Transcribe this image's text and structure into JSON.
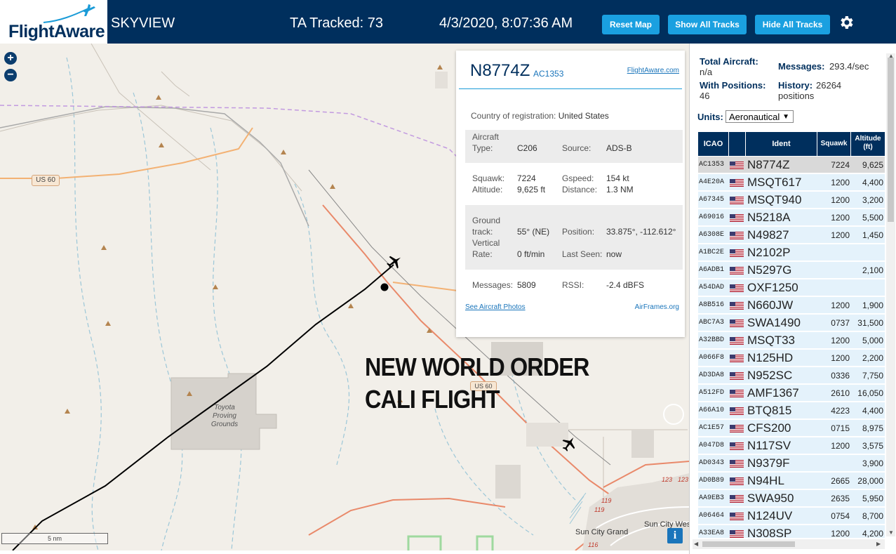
{
  "header": {
    "logo_text": "FlightAware",
    "site_title": "SKYVIEW",
    "ta_tracked": "TA Tracked: 73",
    "datetime": "4/3/2020, 8:07:36 AM",
    "buttons": {
      "reset": "Reset Map",
      "show_all": "Show All Tracks",
      "hide_all": "Hide All Tracks"
    },
    "colors": {
      "bar": "#002f5d",
      "button": "#1aa0e0"
    }
  },
  "map": {
    "zoom_in": "+",
    "zoom_out": "−",
    "scale": "5 nm",
    "info": "i",
    "overlay_line1": "NEW WORLD ORDER",
    "overlay_line2": "CALI FLIGHT",
    "labels": {
      "us60_a": "US 60",
      "us60_b": "US 60",
      "toyota1": "Toyota",
      "toyota2": "Proving",
      "toyota3": "Grounds",
      "r119a": "119",
      "r119b": "119",
      "r123a": "123",
      "r123b": "123",
      "r116": "116",
      "sun_city_grand": "Sun City Grand",
      "sun_city_west": "Sun City West"
    }
  },
  "popup": {
    "ident": "N8774Z",
    "icao": "AC1353",
    "fa_link": "FlightAware.com",
    "country_label": "Country of registration:",
    "country_value": "United States",
    "aircraft_type_label1": "Aircraft",
    "aircraft_type_label2": "Type:",
    "aircraft_type": "C206",
    "source_label": "Source:",
    "source": "ADS-B",
    "squawk_label": "Squawk:",
    "squawk": "7224",
    "gspeed_label": "Gspeed:",
    "gspeed": "154 kt",
    "altitude_label": "Altitude:",
    "altitude": "9,625 ft",
    "distance_label": "Distance:",
    "distance": "1.3 NM",
    "gtrack_label1": "Ground",
    "gtrack_label2": "track:",
    "gtrack": "55° (NE)",
    "position_label": "Position:",
    "position": "33.875°, -112.612°",
    "vrate_label1": "Vertical",
    "vrate_label2": "Rate:",
    "vrate": "0 ft/min",
    "lastseen_label": "Last Seen:",
    "lastseen": "now",
    "messages_label": "Messages:",
    "messages": "5809",
    "rssi_label": "RSSI:",
    "rssi": "-2.4 dBFS",
    "photos_link": "See Aircraft Photos",
    "airframes_link": "AirFrames.org"
  },
  "panel": {
    "total_aircraft_label": "Total Aircraft:",
    "total_aircraft": "n/a",
    "messages_label": "Messages:",
    "messages": "293.4/sec",
    "with_positions_label": "With Positions:",
    "with_positions": "46",
    "history_label": "History:",
    "history_value": "26264",
    "history_unit": "positions",
    "units_label": "Units:",
    "units_value": "Aeronautical",
    "columns": {
      "icao": "ICAO",
      "ident": "Ident",
      "squawk": "Squawk",
      "alt1": "Altitude",
      "alt2": "(ft)"
    },
    "rows": [
      {
        "icao": "AC1353",
        "ident": "N8774Z",
        "squawk": "7224",
        "alt": "9,625"
      },
      {
        "icao": "A4E20A",
        "ident": "MSQT617",
        "squawk": "1200",
        "alt": "4,400"
      },
      {
        "icao": "A67345",
        "ident": "MSQT940",
        "squawk": "1200",
        "alt": "3,200"
      },
      {
        "icao": "A69016",
        "ident": "N5218A",
        "squawk": "1200",
        "alt": "5,500"
      },
      {
        "icao": "A6308E",
        "ident": "N49827",
        "squawk": "1200",
        "alt": "1,450"
      },
      {
        "icao": "A1BC2E",
        "ident": "N2102P",
        "squawk": "",
        "alt": ""
      },
      {
        "icao": "A6ADB1",
        "ident": "N5297G",
        "squawk": "",
        "alt": "2,100"
      },
      {
        "icao": "A54DAD",
        "ident": "OXF1250",
        "squawk": "",
        "alt": ""
      },
      {
        "icao": "A8B516",
        "ident": "N660JW",
        "squawk": "1200",
        "alt": "1,900"
      },
      {
        "icao": "ABC7A3",
        "ident": "SWA1490",
        "squawk": "0737",
        "alt": "31,500"
      },
      {
        "icao": "A32BBD",
        "ident": "MSQT33",
        "squawk": "1200",
        "alt": "5,000"
      },
      {
        "icao": "A066F8",
        "ident": "N125HD",
        "squawk": "1200",
        "alt": "2,200"
      },
      {
        "icao": "AD3DA8",
        "ident": "N952SC",
        "squawk": "0336",
        "alt": "7,750"
      },
      {
        "icao": "A512FD",
        "ident": "AMF1367",
        "squawk": "2610",
        "alt": "16,050"
      },
      {
        "icao": "A66A10",
        "ident": "BTQ815",
        "squawk": "4223",
        "alt": "4,400"
      },
      {
        "icao": "AC1E57",
        "ident": "CFS200",
        "squawk": "0715",
        "alt": "8,975"
      },
      {
        "icao": "A047D8",
        "ident": "N117SV",
        "squawk": "1200",
        "alt": "3,575"
      },
      {
        "icao": "AD0343",
        "ident": "N9379F",
        "squawk": "",
        "alt": "3,900"
      },
      {
        "icao": "AD0B89",
        "ident": "N94HL",
        "squawk": "2665",
        "alt": "28,000"
      },
      {
        "icao": "AA9EB3",
        "ident": "SWA950",
        "squawk": "2635",
        "alt": "5,950"
      },
      {
        "icao": "A06464",
        "ident": "N124UV",
        "squawk": "0754",
        "alt": "8,700"
      },
      {
        "icao": "A33EA8",
        "ident": "N308SP",
        "squawk": "1200",
        "alt": "4,200"
      }
    ]
  }
}
